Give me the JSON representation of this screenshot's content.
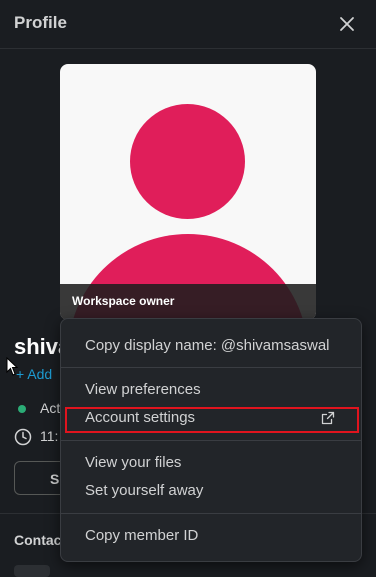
{
  "header": {
    "title": "Profile"
  },
  "avatar": {
    "badge": "Workspace owner",
    "color": "#e01e5a"
  },
  "profile": {
    "name_visible": "shiva",
    "add_link": "Add",
    "status_text": "Act",
    "time_text": "11:",
    "button_partial": "Se",
    "contact_heading": "Contac"
  },
  "menu": {
    "items": [
      {
        "label": "Copy display name: @shivamsaswal"
      },
      {
        "label": "View preferences"
      },
      {
        "label": "Account settings",
        "external": true,
        "highlighted": true
      },
      {
        "label": "View your files"
      },
      {
        "label": "Set yourself away"
      },
      {
        "label": "Copy member ID"
      }
    ]
  },
  "colors": {
    "background": "#1a1d21",
    "menu_bg": "#222529",
    "accent_link": "#1d9bd1",
    "status_active": "#2bac76",
    "highlight_border": "#e0141e"
  }
}
